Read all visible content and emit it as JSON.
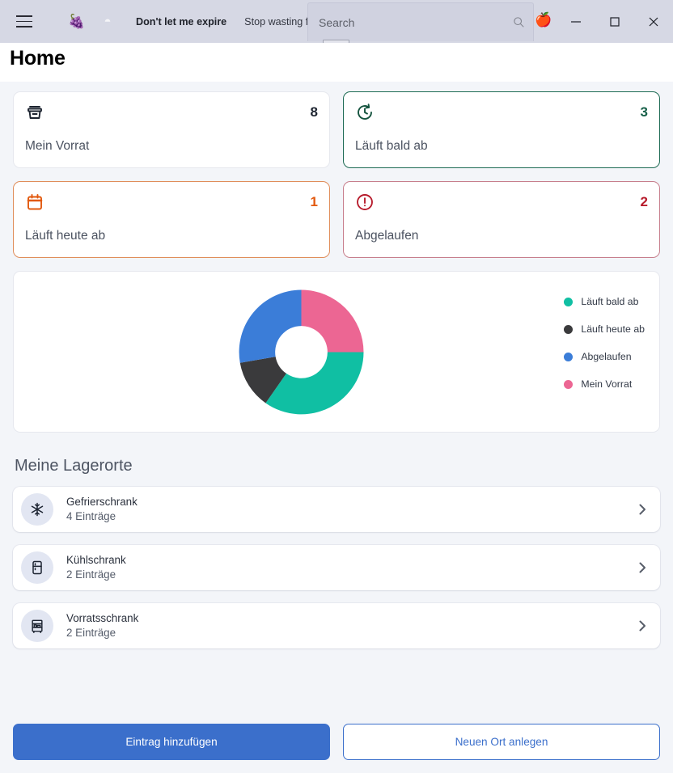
{
  "titlebar": {
    "menu_icon": "hamburger-icon",
    "app_icon": "grape-emoji",
    "theme_icon": "moon-icon",
    "brand": "Don't let me expire",
    "tagline": "Stop wasting food",
    "apple_icon": "apple-emoji",
    "search": {
      "placeholder": "Search",
      "value": "",
      "icon": "search-icon"
    },
    "window": {
      "minimize": "minimize-icon",
      "maximize": "maximize-icon",
      "close": "close-icon"
    }
  },
  "page": {
    "title": "Home"
  },
  "stats": [
    {
      "icon": "archive-box-icon",
      "count": "8",
      "label": "Mein Vorrat",
      "tone": "plain"
    },
    {
      "icon": "clock-refresh-icon",
      "count": "3",
      "label": "Läuft bald ab",
      "tone": "green"
    },
    {
      "icon": "calendar-icon",
      "count": "1",
      "label": "Läuft heute ab",
      "tone": "orange"
    },
    {
      "icon": "alert-circle-icon",
      "count": "2",
      "label": "Abgelaufen",
      "tone": "red"
    }
  ],
  "chart_data": {
    "type": "pie",
    "title": "",
    "legend_position": "right",
    "labels": [
      "Läuft bald ab",
      "Läuft heute ab",
      "Abgelaufen",
      "Mein Vorrat"
    ],
    "values": [
      3,
      1,
      2,
      2
    ],
    "colors": [
      "#10bfa3",
      "#3a3a3c",
      "#3b7dd8",
      "#ec6693"
    ],
    "donut": true,
    "inner_radius_ratio": 0.42,
    "start_angle_deg": 0,
    "slice_angles_deg": [
      125,
      45,
      100,
      90
    ],
    "slice_order_clockwise_from_top": [
      "Mein Vorrat",
      "Läuft bald ab",
      "Läuft heute ab",
      "Abgelaufen"
    ]
  },
  "locations": {
    "heading": "Meine Lagerorte",
    "items": [
      {
        "icon": "snowflake-icon",
        "name": "Gefrierschrank",
        "count": "4 Einträge",
        "chevron": "chevron-right-icon"
      },
      {
        "icon": "fridge-icon",
        "name": "Kühlschrank",
        "count": "2 Einträge",
        "chevron": "chevron-right-icon"
      },
      {
        "icon": "shelf-icon",
        "name": "Vorratsschrank",
        "count": "2 Einträge",
        "chevron": "chevron-right-icon"
      }
    ]
  },
  "footer": {
    "primary": "Eintrag hinzufügen",
    "secondary": "Neuen Ort anlegen"
  },
  "colors": {
    "accent_blue": "#3b6fcb",
    "green": "#176049",
    "orange": "#e2590e",
    "red": "#b71c2c",
    "page_bg": "#f3f5f9",
    "titlebar_bg": "#d6d8e4"
  }
}
